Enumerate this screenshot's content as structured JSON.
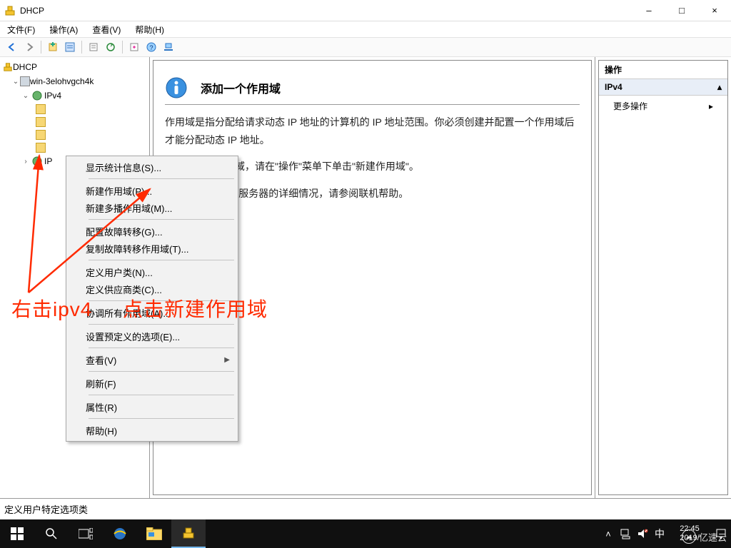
{
  "window": {
    "title": "DHCP",
    "minimize": "–",
    "maximize": "□",
    "close": "×"
  },
  "menubar": {
    "file": "文件(F)",
    "action": "操作(A)",
    "view": "查看(V)",
    "help": "帮助(H)"
  },
  "tree": {
    "root": "DHCP",
    "server": "win-3elohvgch4k",
    "ipv4": "IPv4",
    "ipv6": "IPv6"
  },
  "content": {
    "title": "添加一个作用域",
    "p1": "作用域是指分配给请求动态 IP 地址的计算机的 IP 地址范围。你必须创建并配置一个作用域后才能分配动态 IP 地址。",
    "p2": "若要添加新作用域，请在\"操作\"菜单下单击\"新建作用域\"。",
    "p3": "有关设置 DHCP 服务器的详细情况，请参阅联机帮助。"
  },
  "actions_pane": {
    "title": "操作",
    "header": "IPv4",
    "more": "更多操作"
  },
  "context_menu": {
    "items": [
      {
        "label": "显示统计信息(S)...",
        "sep_after": true
      },
      {
        "label": "新建作用域(P)..."
      },
      {
        "label": "新建多播作用域(M)...",
        "sep_after": true
      },
      {
        "label": "配置故障转移(G)..."
      },
      {
        "label": "复制故障转移作用域(T)...",
        "sep_after": true
      },
      {
        "label": "定义用户类(N)..."
      },
      {
        "label": "定义供应商类(C)...",
        "sep_after": true
      },
      {
        "label": "协调所有作用域(A)...",
        "sep_after": true
      },
      {
        "label": "设置预定义的选项(E)...",
        "sep_after": true
      },
      {
        "label": "查看(V)",
        "submenu": true,
        "sep_after": true
      },
      {
        "label": "刷新(F)",
        "sep_after": true
      },
      {
        "label": "属性(R)",
        "sep_after": true
      },
      {
        "label": "帮助(H)"
      }
    ]
  },
  "statusbar": {
    "text": "定义用户特定选项类"
  },
  "taskbar": {
    "time": "22:45",
    "date": "2019/"
  },
  "annotations": {
    "text1": "右击ipv4",
    "text2": "点击新建作用域"
  },
  "watermark": {
    "text": "亿速云"
  }
}
